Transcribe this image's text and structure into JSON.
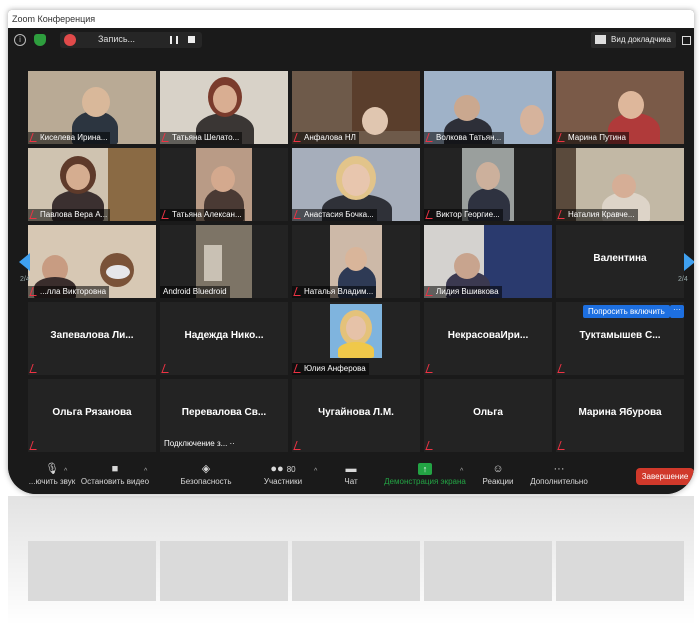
{
  "window": {
    "title": "Zoom Конференция"
  },
  "topbar": {
    "record_label": "Запись...",
    "view_label": "Вид докладчика"
  },
  "pager": {
    "left": "2/4",
    "right": "2/4"
  },
  "participants": [
    {
      "name": "Киселева Ирина..."
    },
    {
      "name": "Татьяна Шелато..."
    },
    {
      "name": "Анфалова НЛ"
    },
    {
      "name": "Волкова Татьян..."
    },
    {
      "name": "Марина Путина"
    },
    {
      "name": "Павлова Вера А..."
    },
    {
      "name": "Татьяна Алексан..."
    },
    {
      "name": "Анастасия Бочка..."
    },
    {
      "name": "Виктор Георгие..."
    },
    {
      "name": "Наталия Кравче..."
    },
    {
      "name": "...лла Викторовна"
    },
    {
      "name": "Android Bluedroid"
    },
    {
      "name": "Наталья Владим..."
    },
    {
      "name": "Лидия Вшивкова"
    },
    {
      "name": "Валентина"
    },
    {
      "name": "Запевалова  Ли..."
    },
    {
      "name": "Надежда  Нико..."
    },
    {
      "name": "Юлия Анферова"
    },
    {
      "name": "НекрасоваИри..."
    },
    {
      "name": "Туктамышев  С..."
    },
    {
      "name": "Ольга Рязанова"
    },
    {
      "name": "Перевалова  Св..."
    },
    {
      "name": "Чугайнова Л.М."
    },
    {
      "name": "Ольга"
    },
    {
      "name": "Марина  Ябурова"
    }
  ],
  "connecting_text": "Подключение з... ··",
  "ask_button": "Попросить включить",
  "more_button": "···",
  "toolbar": {
    "mute": "...ючить звук",
    "video": "Остановить видео",
    "security": "Безопасность",
    "participants": "Участники",
    "participants_count": "80",
    "chat": "Чат",
    "share": "Демонстрация экрана",
    "reactions": "Реакции",
    "more": "Дополнительно",
    "end": "Завершение"
  },
  "colors": {
    "accent": "#1d6fe0",
    "share_green": "#23a344",
    "end_red": "#d0392b"
  }
}
